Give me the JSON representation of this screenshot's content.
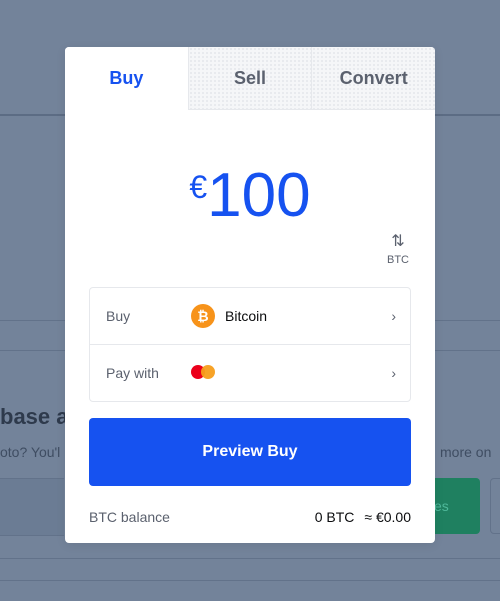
{
  "background": {
    "heading_fragment": "base a",
    "subtext_fragment": "oto? You'l",
    "right_fragment": "more on",
    "green_button_fragment": "es"
  },
  "tabs": [
    {
      "label": "Buy",
      "active": true
    },
    {
      "label": "Sell",
      "active": false
    },
    {
      "label": "Convert",
      "active": false
    }
  ],
  "amount": {
    "currency_symbol": "€",
    "value": "100"
  },
  "switch_currency": {
    "icon": "swap-vertical-icon",
    "code": "BTC"
  },
  "asset_row": {
    "label": "Buy",
    "icon": "bitcoin-icon",
    "icon_glyph": "₿",
    "asset": "Bitcoin",
    "chevron": "›"
  },
  "payment_row": {
    "label": "Pay with",
    "icon": "mastercard-icon",
    "chevron": "›"
  },
  "preview_button": {
    "label": "Preview Buy"
  },
  "balance": {
    "label": "BTC balance",
    "crypto": "0 BTC",
    "fiat": "≈ €0.00"
  },
  "colors": {
    "accent": "#1652f0",
    "bitcoin": "#f7931a",
    "overlay_bg": "#73839a"
  }
}
